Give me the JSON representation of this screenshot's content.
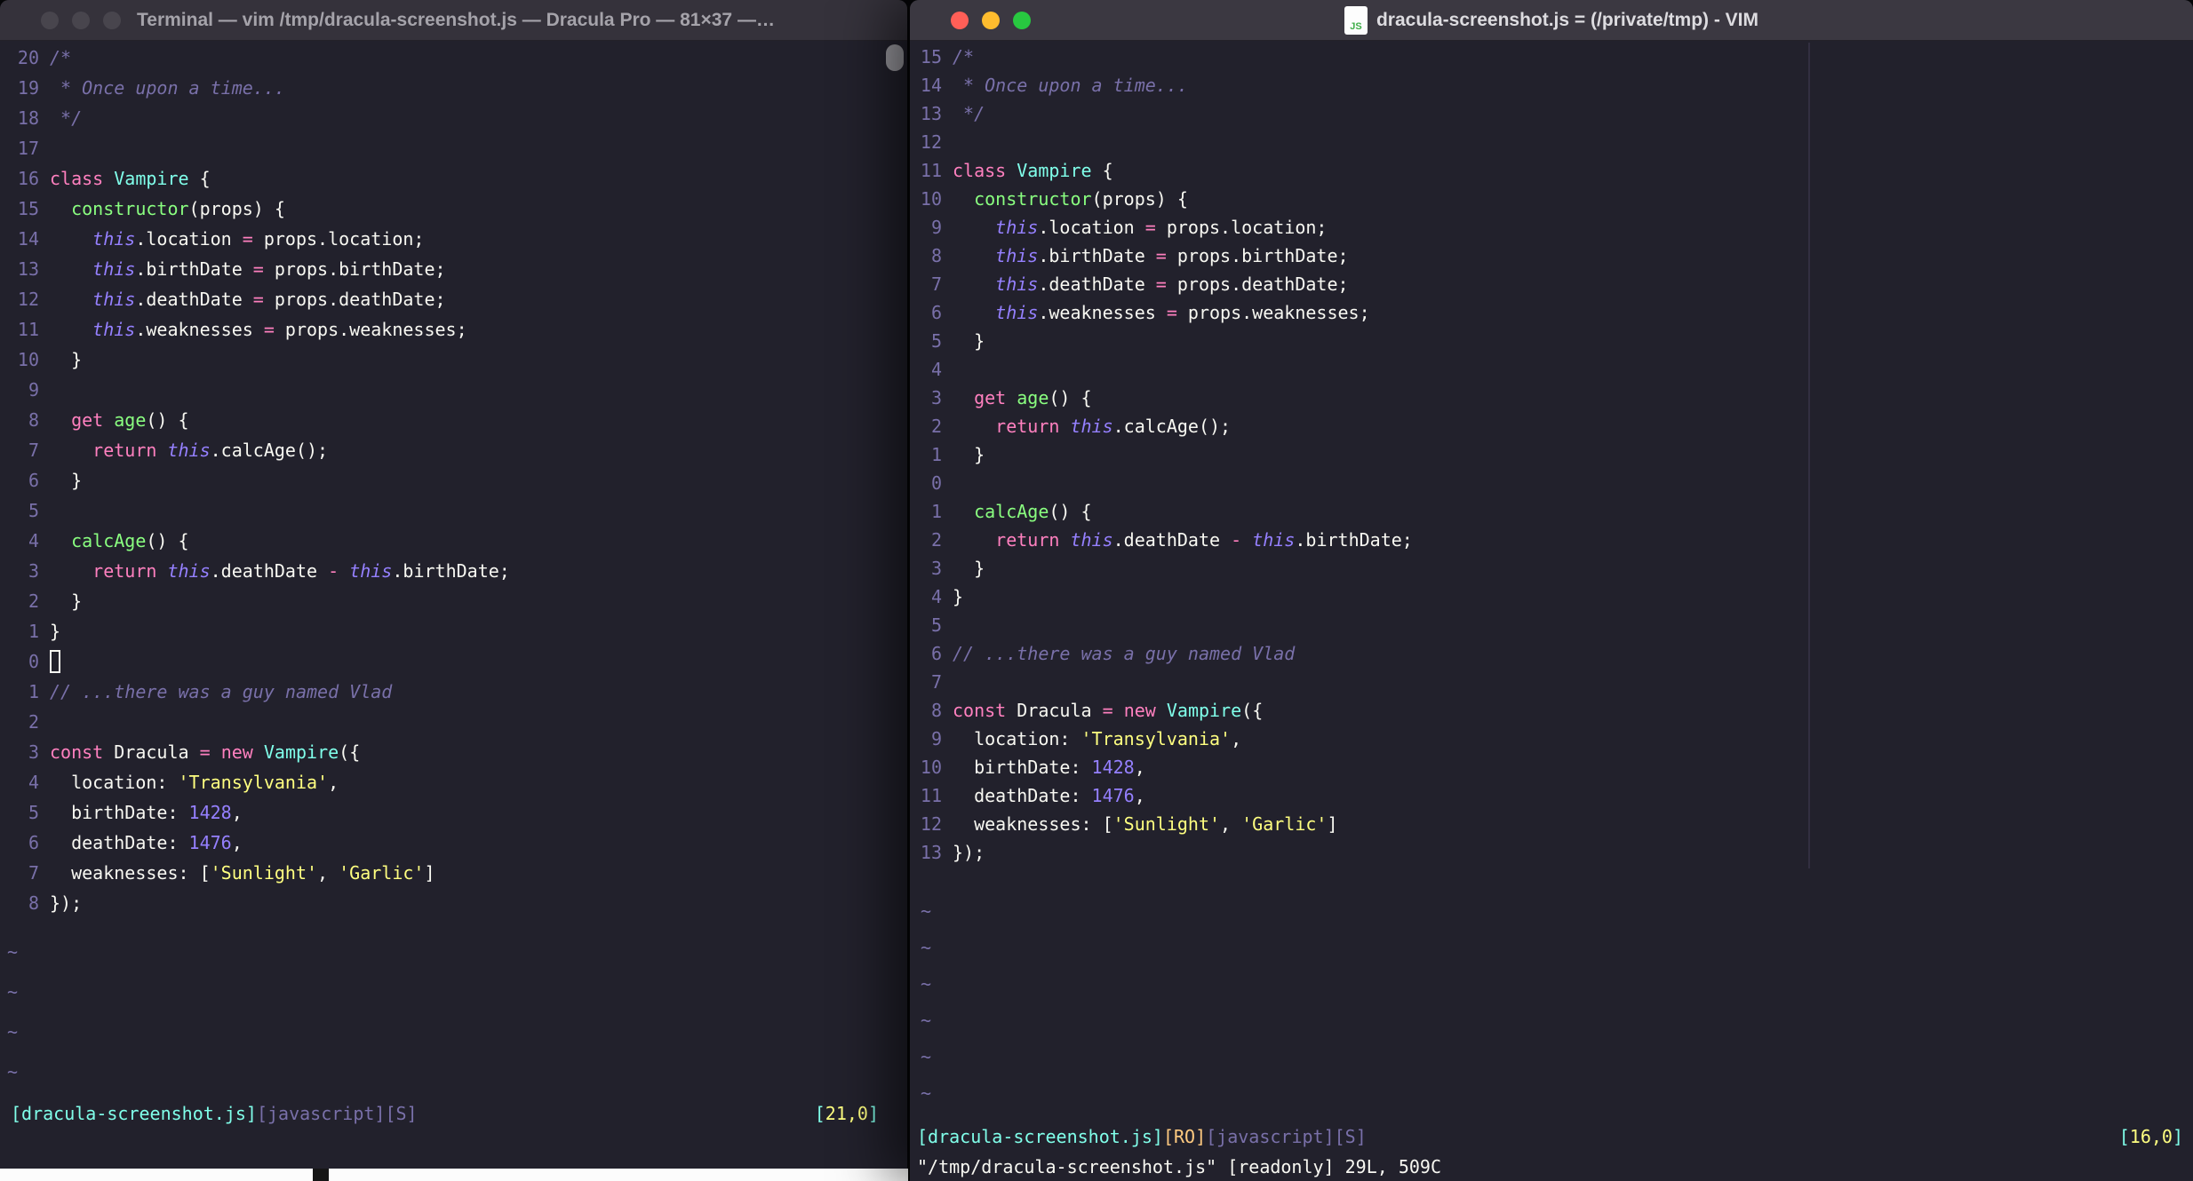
{
  "palette": {
    "background": "#22212C",
    "foreground": "#F8F8F2",
    "comment": "#7970A9",
    "pink": "#FF80BF",
    "green": "#8AFF80",
    "cyan": "#80FFEA",
    "purple": "#9580FF",
    "yellow": "#FFFF80",
    "orange": "#FFCA80",
    "traffic_red": "#FF5F57",
    "traffic_yellow": "#FEBC2E",
    "traffic_green": "#28C840"
  },
  "file": {
    "lines": [
      {
        "tokens": [
          [
            "com",
            "/*"
          ]
        ]
      },
      {
        "tokens": [
          [
            "com",
            " * Once upon a time..."
          ]
        ]
      },
      {
        "tokens": [
          [
            "com",
            " */"
          ]
        ]
      },
      {
        "tokens": []
      },
      {
        "tokens": [
          [
            "kw",
            "class"
          ],
          [
            "fg",
            " "
          ],
          [
            "cls",
            "Vampire"
          ],
          [
            "fg",
            " {"
          ]
        ]
      },
      {
        "tokens": [
          [
            "fg",
            "  "
          ],
          [
            "fn",
            "constructor"
          ],
          [
            "fg",
            "(props) {"
          ]
        ]
      },
      {
        "tokens": [
          [
            "fg",
            "    "
          ],
          [
            "th",
            "this"
          ],
          [
            "fg",
            ".location "
          ],
          [
            "op",
            "="
          ],
          [
            "fg",
            " props.location;"
          ]
        ]
      },
      {
        "tokens": [
          [
            "fg",
            "    "
          ],
          [
            "th",
            "this"
          ],
          [
            "fg",
            ".birthDate "
          ],
          [
            "op",
            "="
          ],
          [
            "fg",
            " props.birthDate;"
          ]
        ]
      },
      {
        "tokens": [
          [
            "fg",
            "    "
          ],
          [
            "th",
            "this"
          ],
          [
            "fg",
            ".deathDate "
          ],
          [
            "op",
            "="
          ],
          [
            "fg",
            " props.deathDate;"
          ]
        ]
      },
      {
        "tokens": [
          [
            "fg",
            "    "
          ],
          [
            "th",
            "this"
          ],
          [
            "fg",
            ".weaknesses "
          ],
          [
            "op",
            "="
          ],
          [
            "fg",
            " props.weaknesses;"
          ]
        ]
      },
      {
        "tokens": [
          [
            "fg",
            "  }"
          ]
        ]
      },
      {
        "tokens": []
      },
      {
        "tokens": [
          [
            "fg",
            "  "
          ],
          [
            "kw",
            "get"
          ],
          [
            "fg",
            " "
          ],
          [
            "fn",
            "age"
          ],
          [
            "fg",
            "() {"
          ]
        ]
      },
      {
        "tokens": [
          [
            "fg",
            "    "
          ],
          [
            "kw",
            "return"
          ],
          [
            "fg",
            " "
          ],
          [
            "th",
            "this"
          ],
          [
            "fg",
            ".calcAge();"
          ]
        ]
      },
      {
        "tokens": [
          [
            "fg",
            "  }"
          ]
        ]
      },
      {
        "tokens": []
      },
      {
        "tokens": [
          [
            "fg",
            "  "
          ],
          [
            "fn",
            "calcAge"
          ],
          [
            "fg",
            "() {"
          ]
        ]
      },
      {
        "tokens": [
          [
            "fg",
            "    "
          ],
          [
            "kw",
            "return"
          ],
          [
            "fg",
            " "
          ],
          [
            "th",
            "this"
          ],
          [
            "fg",
            ".deathDate "
          ],
          [
            "op",
            "-"
          ],
          [
            "fg",
            " "
          ],
          [
            "th",
            "this"
          ],
          [
            "fg",
            ".birthDate;"
          ]
        ]
      },
      {
        "tokens": [
          [
            "fg",
            "  }"
          ]
        ]
      },
      {
        "tokens": [
          [
            "fg",
            "}"
          ]
        ]
      },
      {
        "tokens": []
      },
      {
        "tokens": [
          [
            "com",
            "// ...there was a guy named Vlad"
          ]
        ]
      },
      {
        "tokens": []
      },
      {
        "tokens": [
          [
            "kw",
            "const"
          ],
          [
            "fg",
            " Dracula "
          ],
          [
            "op",
            "="
          ],
          [
            "fg",
            " "
          ],
          [
            "kw",
            "new"
          ],
          [
            "fg",
            " "
          ],
          [
            "cls",
            "Vampire"
          ],
          [
            "fg",
            "({"
          ]
        ]
      },
      {
        "tokens": [
          [
            "fg",
            "  location: "
          ],
          [
            "str",
            "'Transylvania'"
          ],
          [
            "fg",
            ","
          ]
        ]
      },
      {
        "tokens": [
          [
            "fg",
            "  birthDate: "
          ],
          [
            "num",
            "1428"
          ],
          [
            "fg",
            ","
          ]
        ]
      },
      {
        "tokens": [
          [
            "fg",
            "  deathDate: "
          ],
          [
            "num",
            "1476"
          ],
          [
            "fg",
            ","
          ]
        ]
      },
      {
        "tokens": [
          [
            "fg",
            "  weaknesses: ["
          ],
          [
            "str",
            "'Sunlight'"
          ],
          [
            "fg",
            ", "
          ],
          [
            "str",
            "'Garlic'"
          ],
          [
            "fg",
            "]"
          ]
        ]
      },
      {
        "tokens": [
          [
            "fg",
            "});"
          ]
        ]
      }
    ]
  },
  "left_window": {
    "title": "Terminal — vim /tmp/dracula-screenshot.js — Dracula Pro — 81×37 —…",
    "cursor_line": 21,
    "cursor_style": "hollow",
    "tilde_count": 4,
    "status_left": [
      [
        "scyan",
        "[dracula-screenshot.js]"
      ],
      [
        "sdim",
        "[javascript][S]"
      ]
    ],
    "status_right": [
      [
        "scyan",
        "["
      ],
      [
        "syellow",
        "21,0"
      ],
      [
        "scyan",
        "]"
      ]
    ],
    "cmdline": ""
  },
  "right_window": {
    "title": "dracula-screenshot.js = (/private/tmp) - VIM",
    "file_icon_label": "JS",
    "cursor_line": 16,
    "cursor_style": "none",
    "tilde_count": 6,
    "status_left": [
      [
        "scyan",
        "[dracula-screenshot.js]"
      ],
      [
        "sorange",
        "[RO]"
      ],
      [
        "sdim",
        "[javascript][S]"
      ]
    ],
    "status_right": [
      [
        "scyan",
        "["
      ],
      [
        "syellow",
        "16,0"
      ],
      [
        "scyan",
        "]"
      ]
    ],
    "cmdline": "\"/tmp/dracula-screenshot.js\" [readonly] 29L, 509C"
  }
}
